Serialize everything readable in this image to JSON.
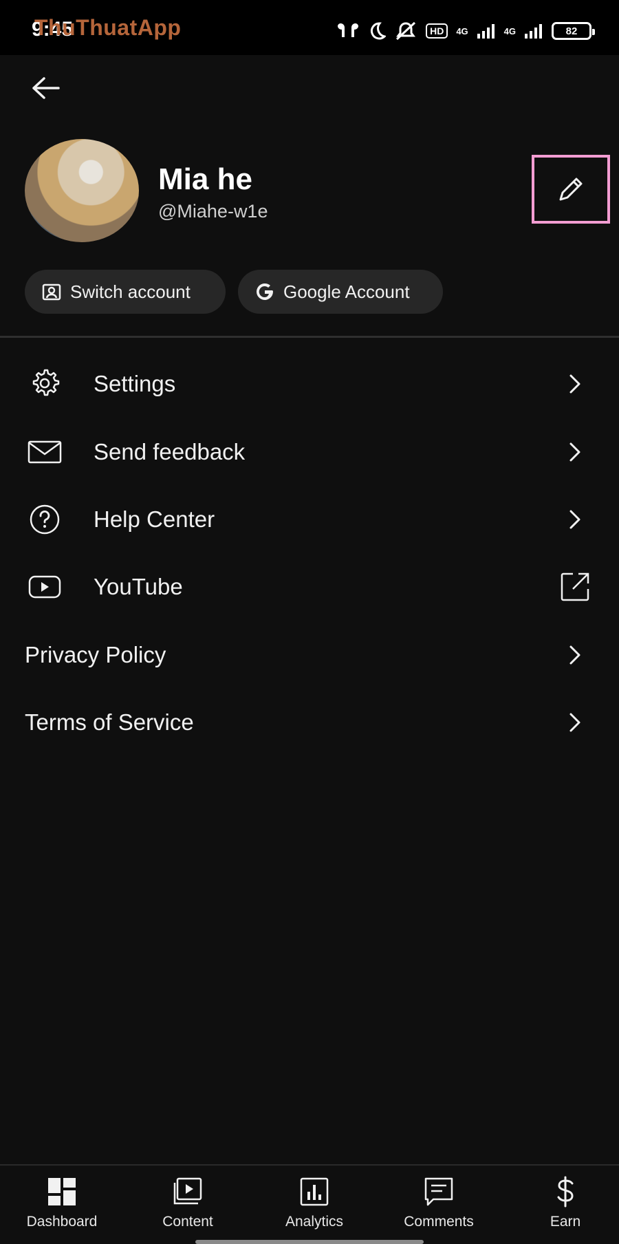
{
  "status_bar": {
    "time": "9:45",
    "watermark": "ThuThuatApp",
    "hd_badge": "HD",
    "network_1": "4G",
    "network_2": "4G",
    "battery": "82"
  },
  "profile": {
    "display_name": "Mia he",
    "handle": "@Miahe-w1e"
  },
  "chips": {
    "switch_account": "Switch account",
    "google_account": "Google Account"
  },
  "menu": [
    {
      "label": "Settings",
      "icon": "gear-icon",
      "trail": "chevron-right-icon"
    },
    {
      "label": "Send feedback",
      "icon": "mail-icon",
      "trail": "chevron-right-icon"
    },
    {
      "label": "Help Center",
      "icon": "help-circle-icon",
      "trail": "chevron-right-icon"
    },
    {
      "label": "YouTube",
      "icon": "youtube-icon",
      "trail": "external-link-icon"
    },
    {
      "label": "Privacy Policy",
      "icon": "",
      "trail": "chevron-right-icon"
    },
    {
      "label": "Terms of Service",
      "icon": "",
      "trail": "chevron-right-icon"
    }
  ],
  "bottom_nav": [
    {
      "label": "Dashboard",
      "icon": "dashboard-icon",
      "active": true
    },
    {
      "label": "Content",
      "icon": "content-icon",
      "active": false
    },
    {
      "label": "Analytics",
      "icon": "analytics-icon",
      "active": false
    },
    {
      "label": "Comments",
      "icon": "comments-icon",
      "active": false
    },
    {
      "label": "Earn",
      "icon": "dollar-icon",
      "active": false
    }
  ],
  "colors": {
    "background": "#0f0f0f",
    "chip": "#272727",
    "highlight_border": "#f39dd2",
    "watermark": "#b5653a"
  }
}
